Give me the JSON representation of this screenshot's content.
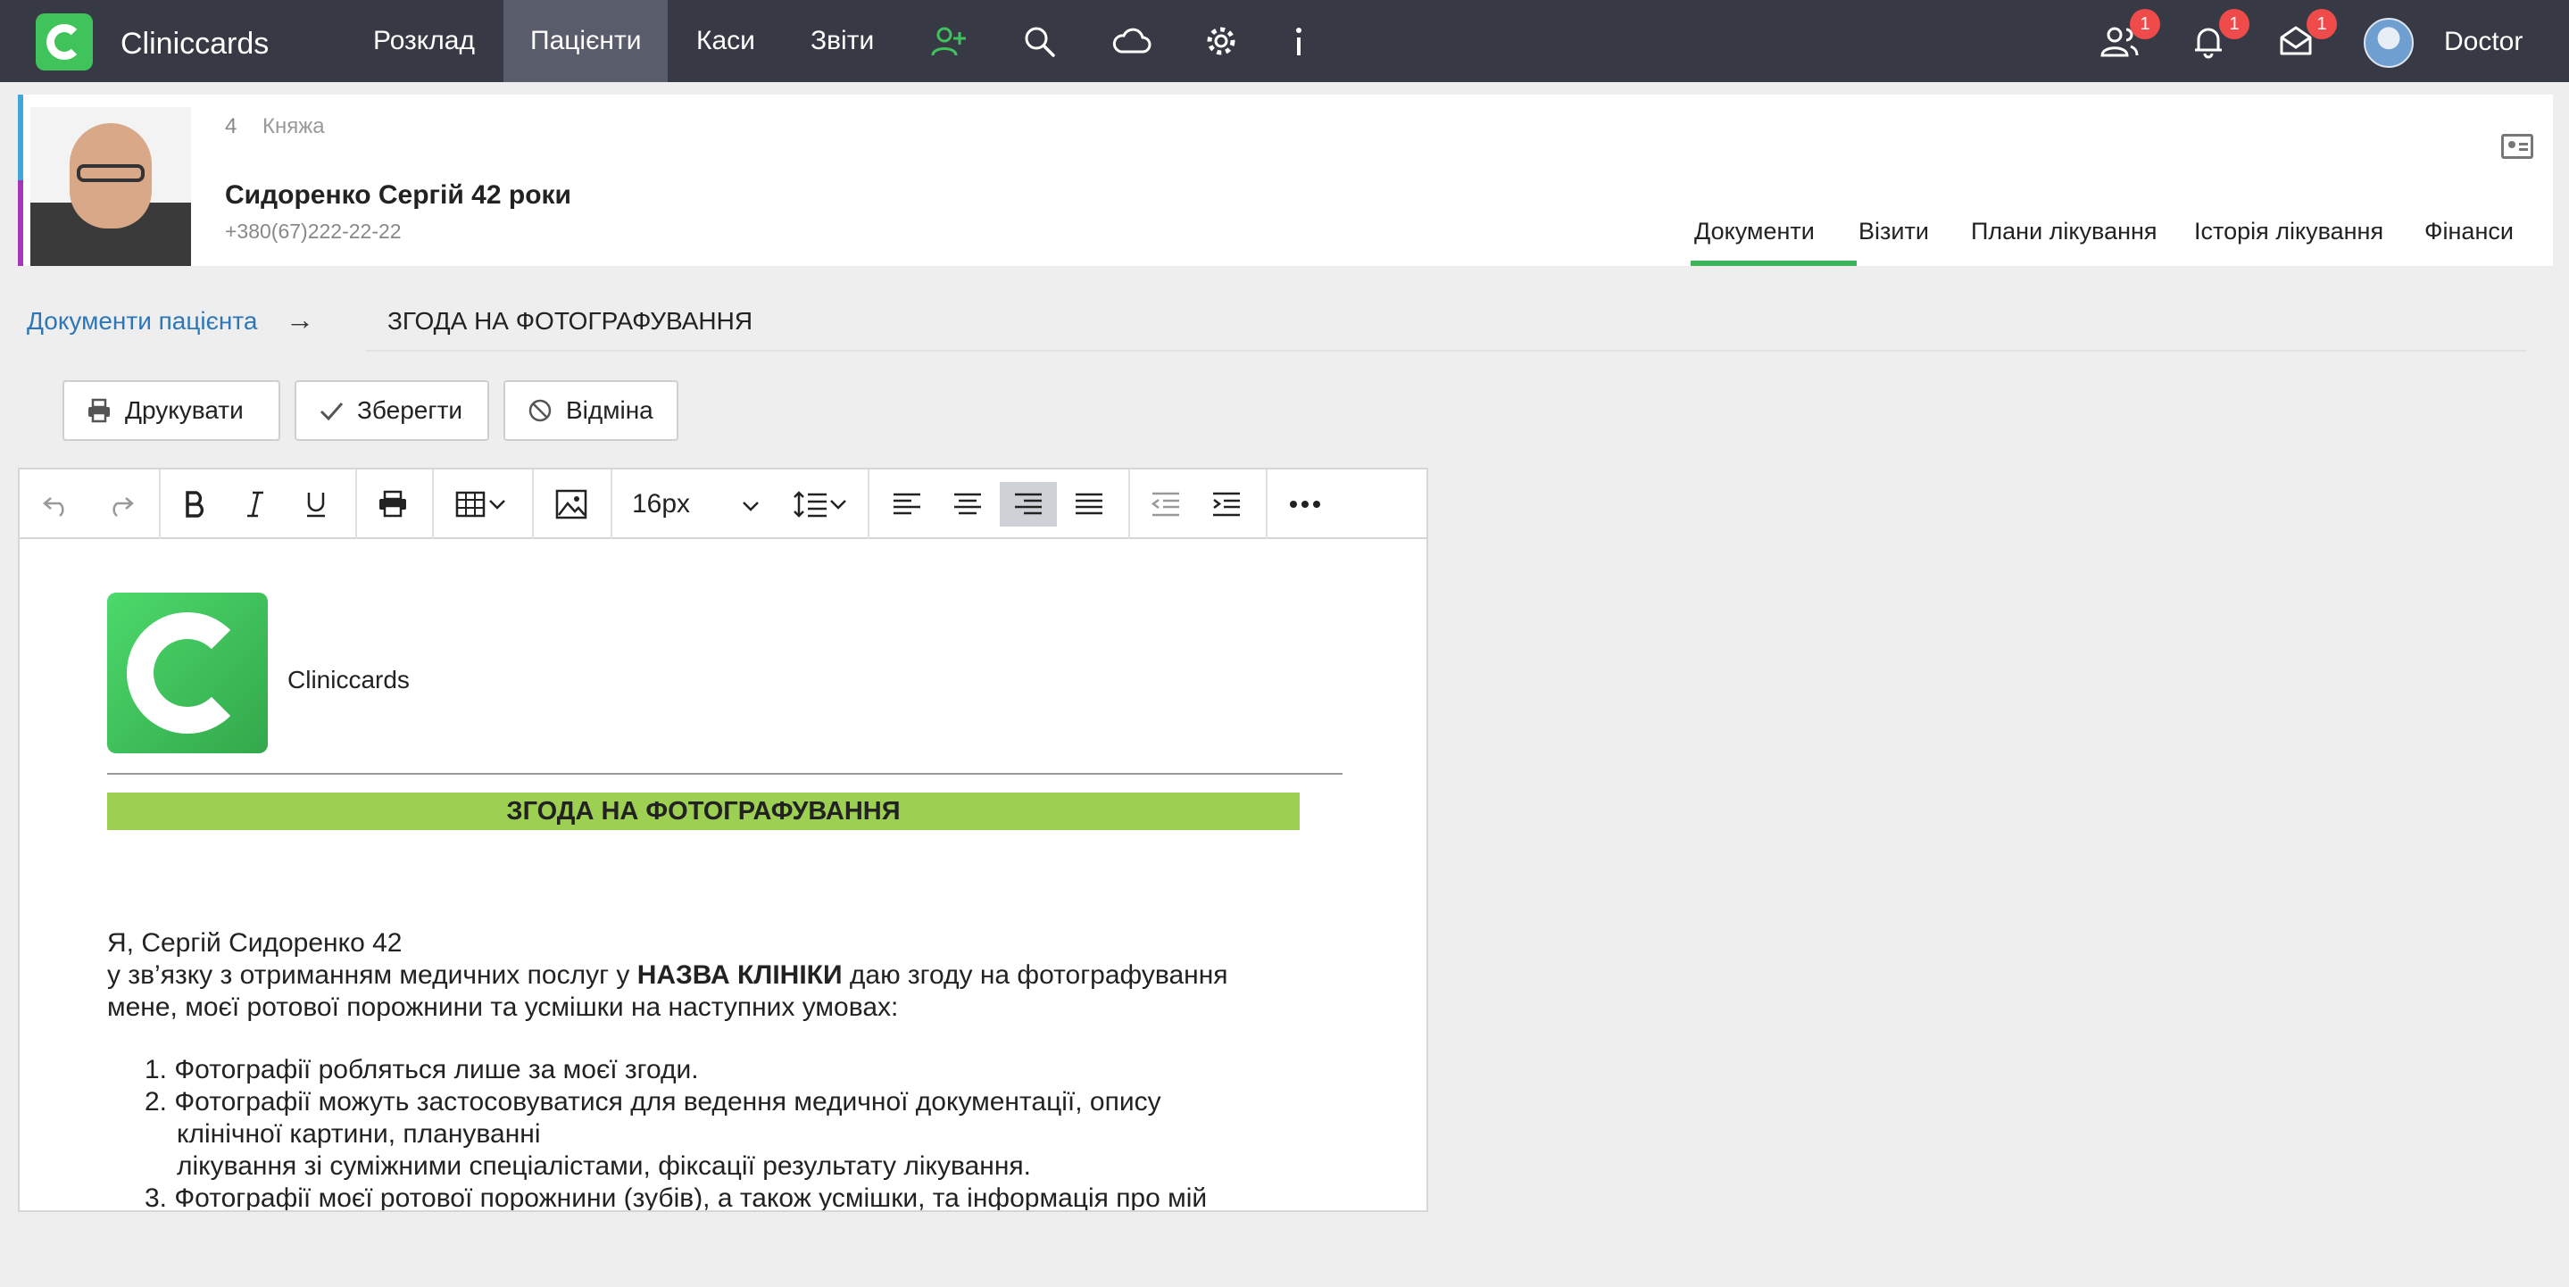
{
  "nav": {
    "brand": "Cliniccards",
    "items": [
      {
        "label": "Розклад"
      },
      {
        "label": "Пацієнти"
      },
      {
        "label": "Каси"
      },
      {
        "label": "Звіти"
      }
    ],
    "badges": {
      "users": "1",
      "bell": "1",
      "mail": "1"
    },
    "user_name": "Doctor"
  },
  "patient": {
    "number": "4",
    "branch": "Княжа",
    "name": "Сидоренко Сергій  42 роки",
    "phone": "+380(67)222-22-22",
    "tabs": [
      {
        "label": "Документи"
      },
      {
        "label": "Візити"
      },
      {
        "label": "Плани лікування"
      },
      {
        "label": "Історія лікування"
      },
      {
        "label": "Фінанси"
      }
    ]
  },
  "breadcrumb": {
    "link": "Документи пацієнта",
    "arrow": "→",
    "title": "ЗГОДА НА ФОТОГРАФУВАННЯ"
  },
  "actions": {
    "print": "Друкувати",
    "save": "Зберегти",
    "cancel": "Відміна"
  },
  "toolbar": {
    "font_size": "16px"
  },
  "document": {
    "brand": "Cliniccards",
    "banner": "ЗГОДА НА ФОТОГРАФУВАННЯ",
    "line1": "Я, Сергій Сидоренко 42",
    "line2_pre": "у зв’язку з отриманням медичних послуг у ",
    "line2_bold": "НАЗВА КЛІНІКИ",
    "line2_post": " даю згоду на фотографування",
    "line3": "мене, моєї ротової порожнини та усмішки на наступних умовах:",
    "list": [
      "1. Фотографії робляться лише за моєї згоди.",
      "2. Фотографії можуть застосовуватися для ведення медичної документації, опису",
      "клінічної картини, плануванні",
      "лікування зі суміжними спеціалістами, фіксації результату лікування.",
      "3. Фотографії моєї ротової порожнини (зубів), а також усмішки, та інформація про мій"
    ]
  }
}
